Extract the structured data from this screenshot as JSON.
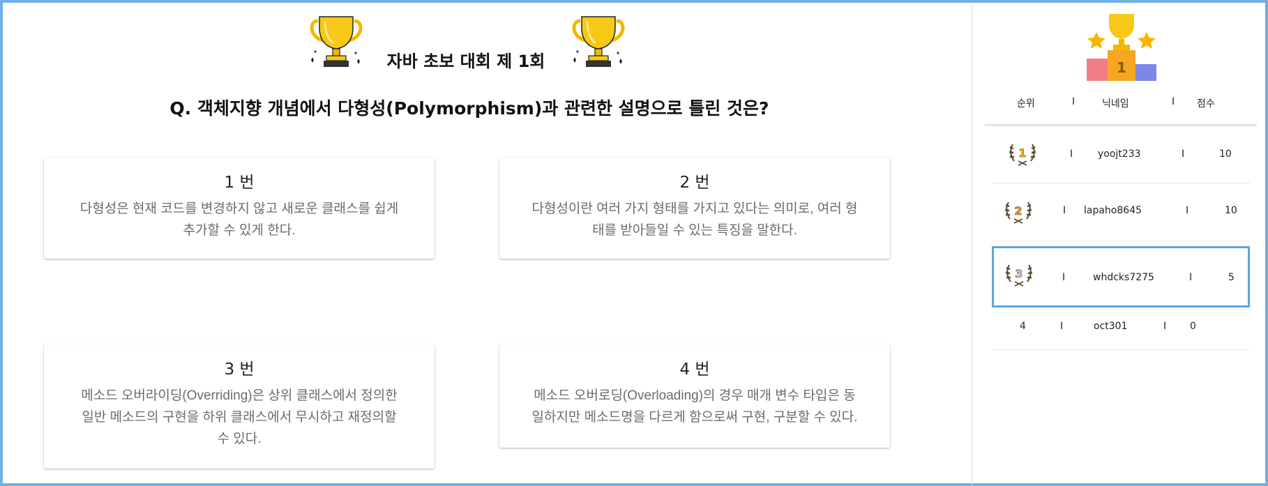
{
  "contest": {
    "title": "자바 초보 대회 제 1회"
  },
  "question": {
    "text": "Q. 객체지향 개념에서 다형성(Polymorphism)과 관련한 설명으로 틀린 것은?"
  },
  "options": [
    {
      "number": "1 번",
      "line1": "다형성은 현재 코드를 변경하지 않고 새로운 클래스를 쉽게",
      "line2": "추가할 수 있게 한다.",
      "line3": ""
    },
    {
      "number": "2 번",
      "line1": "다형성이란 여러 가지 형태를 가지고 있다는 의미로, 여러 형",
      "line2": "태를 받아들일 수 있는 특징을 말한다.",
      "line3": ""
    },
    {
      "number": "3 번",
      "line1": "메소드 오버라이딩(Overriding)은 상위 클래스에서 정의한",
      "line2": "일반 메소드의 구현을 하위 클래스에서 무시하고 재정의할",
      "line3": "수 있다."
    },
    {
      "number": "4 번",
      "line1": "메소드 오버로딩(Overloading)의 경우 매개 변수 타입은 동",
      "line2": "일하지만 메소드명을 다르게 함으로써 구현, 구분할 수 있다.",
      "line3": ""
    }
  ],
  "ranking": {
    "headers": {
      "rank": "순위",
      "nickname": "닉네임",
      "score": "점수",
      "separator": "I"
    },
    "rows": [
      {
        "rank": "1",
        "nickname": "yoojt233",
        "score": "10"
      },
      {
        "rank": "2",
        "nickname": "lapaho8645",
        "score": "10"
      },
      {
        "rank": "3",
        "nickname": "whdcks7275",
        "score": "5"
      },
      {
        "rank": "4",
        "nickname": "oct301",
        "score": "0"
      }
    ]
  },
  "colors": {
    "border": "#6fb0e6",
    "highlight": "#5aa7e0",
    "trophy_gold": "#f7c815",
    "text_muted": "#6b6b6b"
  },
  "icons": {
    "contest": "trophy-icon",
    "leaderboard": "podium-icon",
    "top_ranks": "laurel-medal-icon"
  }
}
